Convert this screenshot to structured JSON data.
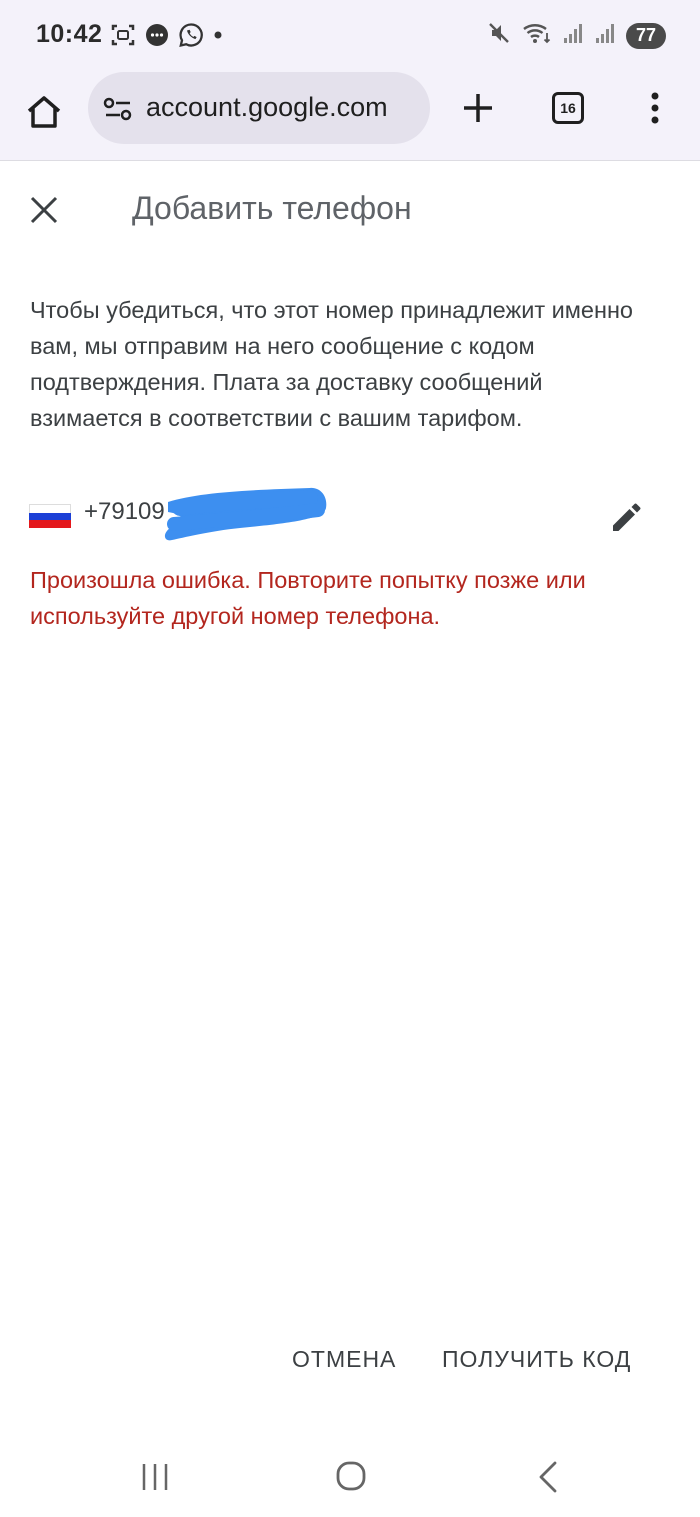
{
  "status_bar": {
    "time": "10:42",
    "battery": "77",
    "icons": [
      "screenshot-icon",
      "messages-icon",
      "whatsapp-icon",
      "dot-icon",
      "mute-icon",
      "wifi-icon",
      "signal-icon",
      "signal-icon"
    ]
  },
  "browser": {
    "url": "account.google.com",
    "tab_count": "16",
    "icons": [
      "home-icon",
      "site-settings-icon",
      "plus-icon",
      "menu-dots-icon"
    ]
  },
  "dialog": {
    "title": "Добавить телефон",
    "description": "Чтобы убедиться, что этот номер принадлежит именно вам, мы отправим на него сообщение с кодом подтверждения. Плата за доставку сообщений взимается в соответствии с вашим тарифом.",
    "phone": "+79109",
    "country_flag": "russia-flag",
    "error": "Произошла ошибка. Повторите попытку позже или используйте другой номер телефона.",
    "cancel_label": "ОТМЕНА",
    "get_code_label": "ПОЛУЧИТЬ КОД"
  },
  "colors": {
    "error": "#b3261e",
    "redaction": "#3d8ff0",
    "flag_white": "#ffffff",
    "flag_blue": "#1c3fd6",
    "flag_red": "#e4181c"
  }
}
